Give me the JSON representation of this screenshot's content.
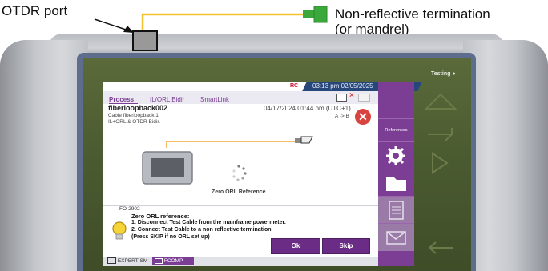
{
  "annotations": {
    "otdr_port_label": "OTDR port",
    "termination_label_line1": "Non-reflective termination",
    "termination_label_line2": "(or mandrel)"
  },
  "device": {
    "indicator_label": "Testing"
  },
  "status_bar": {
    "datetime": "03:13 pm 02/05/2025"
  },
  "tabs": [
    "Process",
    "IL/ORL Bidir",
    "SmartLink"
  ],
  "test_info": {
    "name": "fiberloopback002",
    "cable": "Cable fiberloopback 1",
    "test_type": "IL+ORL & OTDR Bidir.",
    "date": "04/17/2024 01:44 pm (UTC+1)",
    "direction": "A -> B"
  },
  "side_panel": {
    "references_label": "References",
    "icons": [
      "gear-icon",
      "folder-icon",
      "report-icon",
      "mail-icon"
    ]
  },
  "main": {
    "caption": "Zero ORL Reference"
  },
  "dialog": {
    "code": "FO-2902",
    "title": "Zero ORL reference:",
    "line1": "1. Disconnect Test Cable from the mainframe powermeter.",
    "line2": "2. Connect Test Cable to a non reflective termination.",
    "line3": "(Press SKIP if no ORL set up)",
    "ok_label": "Ok",
    "skip_label": "Skip"
  },
  "footer": {
    "module1": "EXPERT-SM",
    "module2": "FCOMP"
  },
  "colors": {
    "accent": "#7b3e94",
    "status_blue": "#27477a",
    "close_red": "#d9433f",
    "annotation_line": "#f2c230",
    "termination_green": "#3aa83a"
  }
}
